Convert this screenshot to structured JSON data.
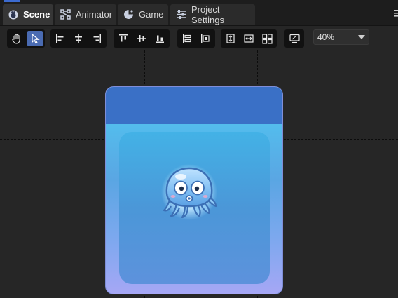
{
  "tabs": [
    {
      "label": "Scene",
      "icon": "scene-icon",
      "active": true
    },
    {
      "label": "Animator",
      "icon": "animator-icon",
      "active": false
    },
    {
      "label": "Game",
      "icon": "game-icon",
      "active": false
    },
    {
      "label": "Project Settings",
      "icon": "sliders-icon",
      "active": false
    }
  ],
  "toolbar": {
    "groups": [
      [
        "hand-tool-icon",
        "select-tool-icon"
      ],
      [
        "align-left-icon",
        "align-center-h-icon",
        "align-right-icon"
      ],
      [
        "align-top-icon",
        "align-middle-v-icon",
        "align-bottom-icon"
      ],
      [
        "distribute-h-icon",
        "distribute-v-icon"
      ],
      [
        "resize-height-icon",
        "resize-width-icon",
        "grid-icon"
      ],
      [
        "device-preview-icon"
      ]
    ],
    "zoom": "40%"
  },
  "colors": {
    "accent": "#4a6bb2",
    "card_header": "#3a70c6",
    "card_top": "#4fcbf3",
    "card_bottom": "#a6a7f5"
  },
  "scene": {
    "sprite": "octopus-character"
  }
}
